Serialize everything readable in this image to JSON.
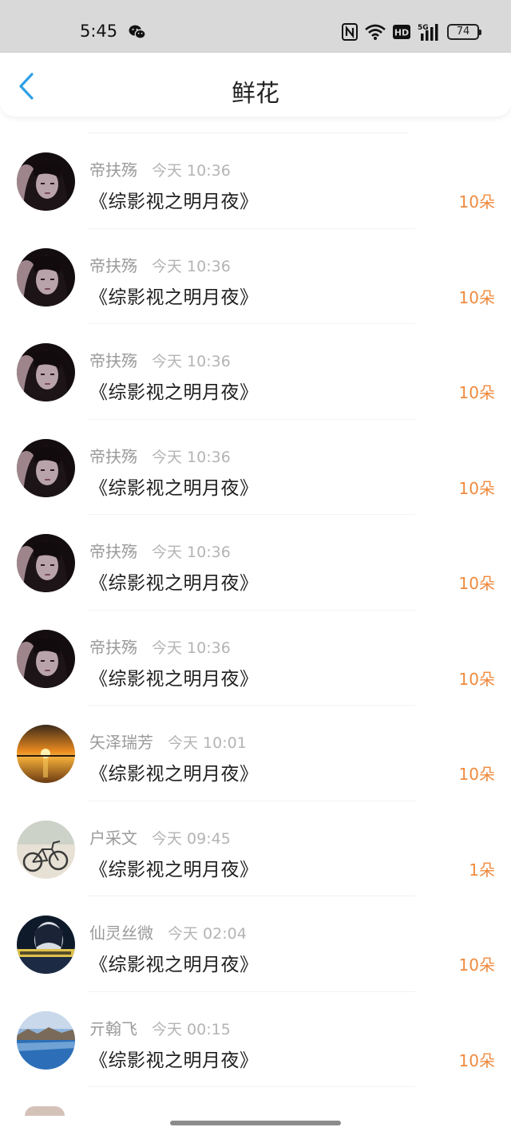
{
  "status_bar": {
    "time": "5:45",
    "signal_text": "5G",
    "battery": "74",
    "icons": [
      "wechat-icon",
      "nfc-icon",
      "wifi-icon",
      "hd-icon",
      "signal-icon",
      "battery-icon"
    ]
  },
  "nav": {
    "title": "鲜花",
    "back_icon": "chevron-left-icon",
    "accent_color": "#2fa0e6"
  },
  "colors": {
    "count": "#f08a3e",
    "meta": "#9a9a9a",
    "title": "#1f1f1f"
  },
  "rows": [
    {
      "name": "帝扶殇",
      "time": "今天 10:36",
      "book": "《综影视之明月夜》",
      "count": "10朵",
      "avatar": "dark-hair-portrait"
    },
    {
      "name": "帝扶殇",
      "time": "今天 10:36",
      "book": "《综影视之明月夜》",
      "count": "10朵",
      "avatar": "dark-hair-portrait"
    },
    {
      "name": "帝扶殇",
      "time": "今天 10:36",
      "book": "《综影视之明月夜》",
      "count": "10朵",
      "avatar": "dark-hair-portrait"
    },
    {
      "name": "帝扶殇",
      "time": "今天 10:36",
      "book": "《综影视之明月夜》",
      "count": "10朵",
      "avatar": "dark-hair-portrait"
    },
    {
      "name": "帝扶殇",
      "time": "今天 10:36",
      "book": "《综影视之明月夜》",
      "count": "10朵",
      "avatar": "dark-hair-portrait"
    },
    {
      "name": "帝扶殇",
      "time": "今天 10:36",
      "book": "《综影视之明月夜》",
      "count": "10朵",
      "avatar": "dark-hair-portrait"
    },
    {
      "name": "矢泽瑞芳",
      "time": "今天 10:01",
      "book": "《综影视之明月夜》",
      "count": "10朵",
      "avatar": "sunset"
    },
    {
      "name": "户采文",
      "time": "今天 09:45",
      "book": "《综影视之明月夜》",
      "count": "1朵",
      "avatar": "bicycle"
    },
    {
      "name": "仙灵丝微",
      "time": "今天 02:04",
      "book": "《综影视之明月夜》",
      "count": "10朵",
      "avatar": "night-figure"
    },
    {
      "name": "亓翰飞",
      "time": "今天 00:15",
      "book": "《综影视之明月夜》",
      "count": "10朵",
      "avatar": "lake-landscape"
    }
  ]
}
